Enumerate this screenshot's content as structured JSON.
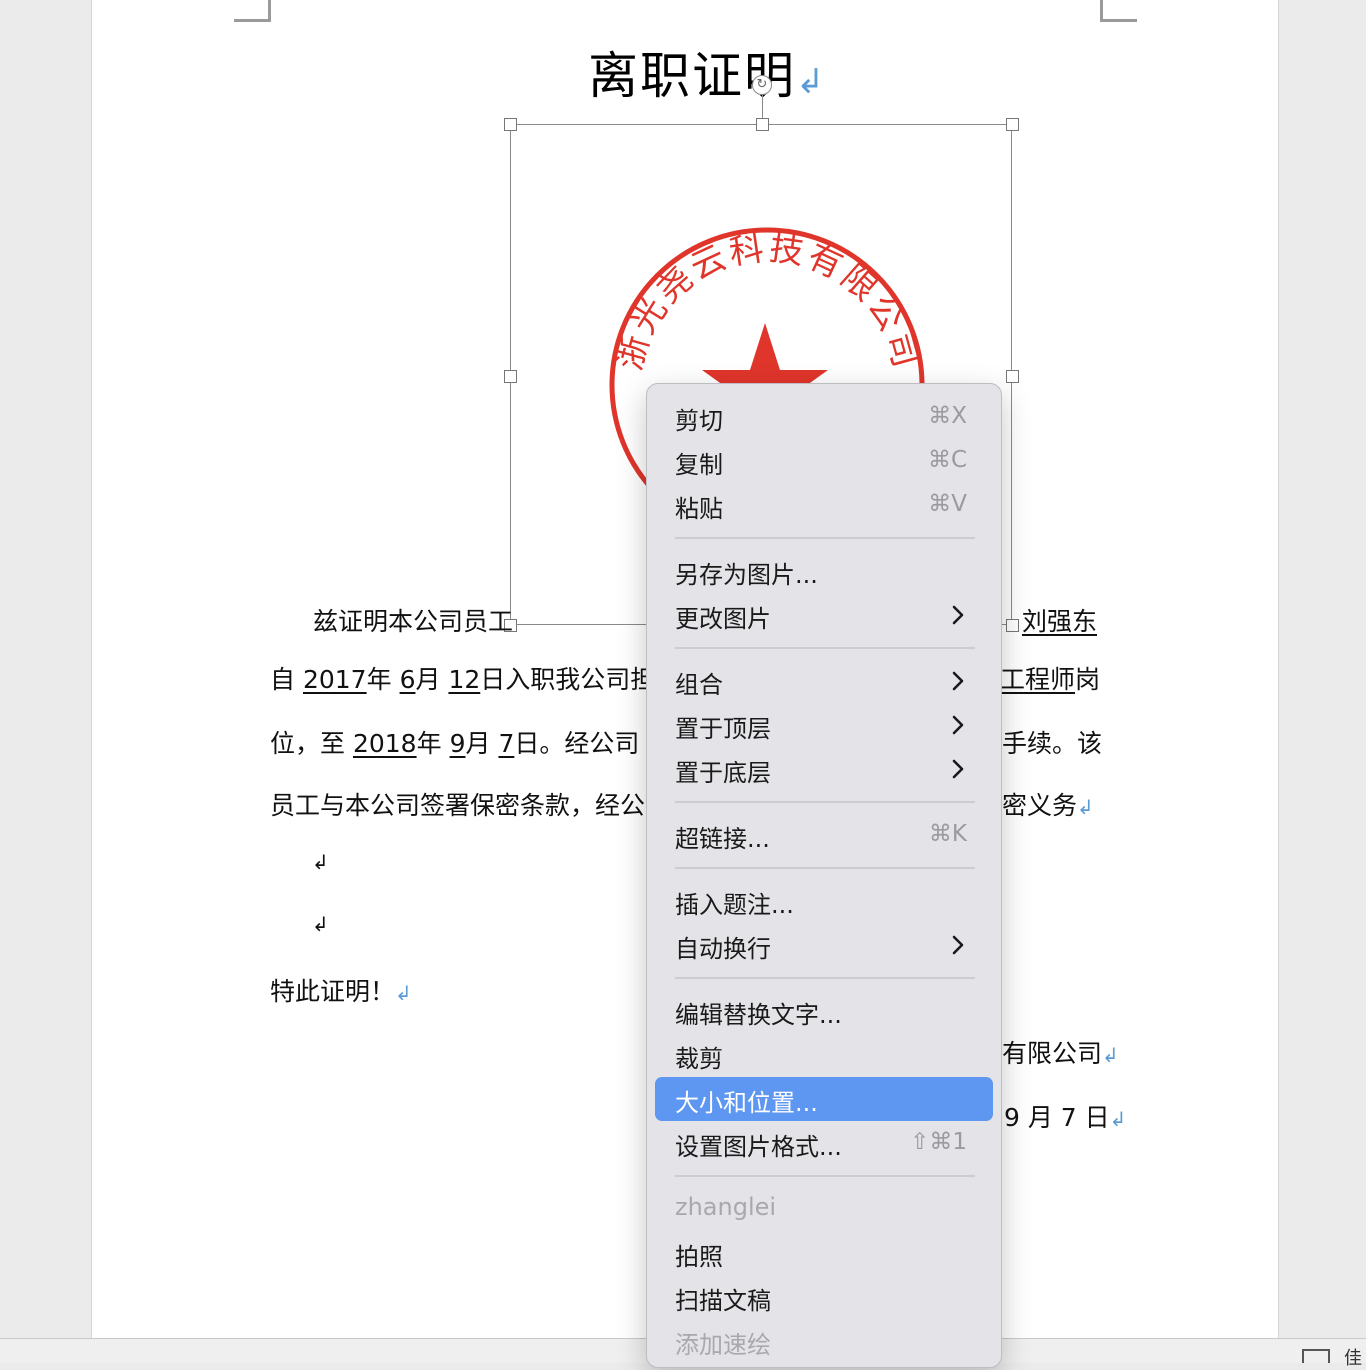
{
  "document": {
    "title": "离职证明",
    "para_mark": "↲",
    "body": {
      "l1_a": "兹证明本公司员工",
      "l1_name": "刘强东",
      "l2_a": "自",
      "l2_year": "2017",
      "l2_b": "年",
      "l2_month": "6",
      "l2_c": "月",
      "l2_day": "12",
      "l2_d": "日入职我公司担",
      "l2_job": "工程师",
      "l2_e": "岗",
      "l3_a": "位，至",
      "l3_year": "2018",
      "l3_b": "年",
      "l3_month": "9",
      "l3_c": "月",
      "l3_day": "7",
      "l3_d": "日。经公司",
      "l3_e": "手续。该",
      "l4_a": "员工与本公司签署保密条款，经公",
      "l4_b": "密义务",
      "closing": "特此证明！",
      "sig_company": "有限公司",
      "sig_date": "9 月 7 日"
    },
    "seal": {
      "text": "浙光尧云科技有限公司",
      "color": "#e0352b"
    }
  },
  "context_menu": {
    "items": [
      {
        "label": "剪切",
        "shortcut": "⌘X"
      },
      {
        "label": "复制",
        "shortcut": "⌘C"
      },
      {
        "label": "粘贴",
        "shortcut": "⌘V"
      },
      {
        "label": "另存为图片..."
      },
      {
        "label": "更改图片",
        "submenu": true
      },
      {
        "label": "组合",
        "submenu": true
      },
      {
        "label": "置于顶层",
        "submenu": true
      },
      {
        "label": "置于底层",
        "submenu": true
      },
      {
        "label": "超链接...",
        "shortcut": "⌘K"
      },
      {
        "label": "插入题注..."
      },
      {
        "label": "自动换行",
        "submenu": true
      },
      {
        "label": "编辑替换文字..."
      },
      {
        "label": "裁剪"
      },
      {
        "label": "大小和位置...",
        "highlighted": true
      },
      {
        "label": "设置图片格式...",
        "shortcut": "⇧⌘1"
      },
      {
        "label": "zhanglei",
        "disabled": true
      },
      {
        "label": "拍照"
      },
      {
        "label": "扫描文稿"
      },
      {
        "label": "添加速绘",
        "disabled": true
      }
    ],
    "highlight_color": "#5e97f2"
  },
  "statusbar": {
    "partial_text": "佳"
  }
}
